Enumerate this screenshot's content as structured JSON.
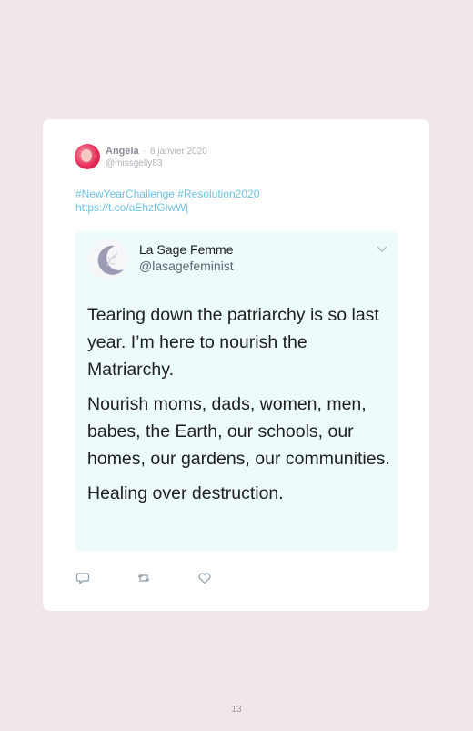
{
  "tweet": {
    "author_name": "Angela",
    "separator": "·",
    "date": "6 janvier 2020",
    "author_handle": "@missgelly83",
    "hashtags": "#NewYearChallenge #Resolution2020",
    "link": "https://t.co/aEhzfGlwWj"
  },
  "quoted_tweet": {
    "name": "La Sage Femme",
    "handle": "@lasagefeminist",
    "paragraphs": [
      "Tearing down the patriarchy is so last year. I’m here to nourish the Matriarchy.",
      "Nourish moms, dads, women, men, babes, the Earth, our schools, our homes, our gardens, our communities.",
      "Healing over destruction."
    ]
  },
  "actions": [
    "reply-icon",
    "retweet-icon",
    "like-icon"
  ],
  "page_number": "13",
  "colors": {
    "background": "#f1e6e8",
    "card": "#ffffff",
    "link": "#6ec1e4",
    "quote_background": "#edfbfb"
  }
}
